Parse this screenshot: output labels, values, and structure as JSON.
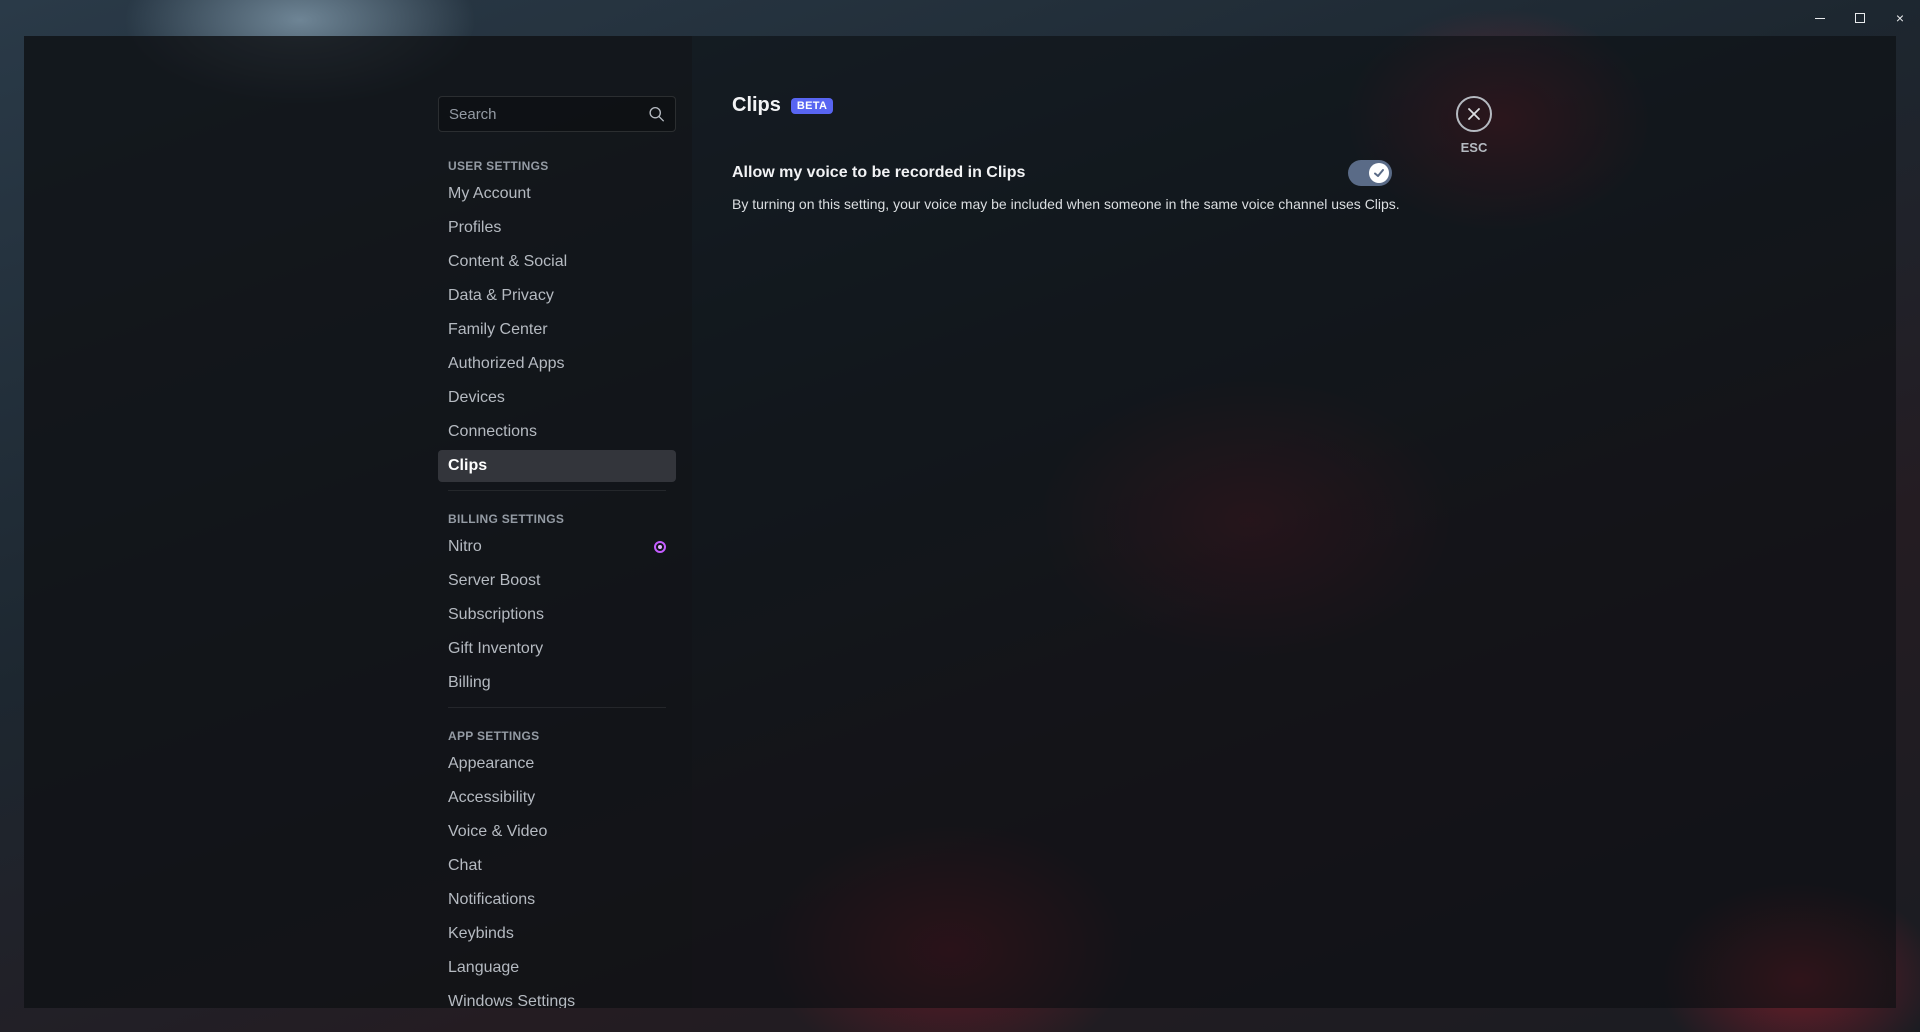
{
  "window_controls": {
    "minimize": "minimize",
    "maximize": "maximize",
    "close": "×"
  },
  "sidebar": {
    "search": {
      "placeholder": "Search",
      "value": ""
    },
    "sections": [
      {
        "header": "User Settings",
        "items": [
          {
            "label": "My Account"
          },
          {
            "label": "Profiles"
          },
          {
            "label": "Content & Social"
          },
          {
            "label": "Data & Privacy"
          },
          {
            "label": "Family Center"
          },
          {
            "label": "Authorized Apps"
          },
          {
            "label": "Devices"
          },
          {
            "label": "Connections"
          },
          {
            "label": "Clips",
            "active": true
          }
        ]
      },
      {
        "header": "Billing Settings",
        "items": [
          {
            "label": "Nitro",
            "badge": "nitro-icon"
          },
          {
            "label": "Server Boost"
          },
          {
            "label": "Subscriptions"
          },
          {
            "label": "Gift Inventory"
          },
          {
            "label": "Billing"
          }
        ]
      },
      {
        "header": "App Settings",
        "items": [
          {
            "label": "Appearance"
          },
          {
            "label": "Accessibility"
          },
          {
            "label": "Voice & Video"
          },
          {
            "label": "Chat"
          },
          {
            "label": "Notifications"
          },
          {
            "label": "Keybinds"
          },
          {
            "label": "Language"
          },
          {
            "label": "Windows Settings"
          }
        ]
      }
    ]
  },
  "content": {
    "title": "Clips",
    "badge": "BETA",
    "setting": {
      "label": "Allow my voice to be recorded in Clips",
      "enabled": true,
      "description": "By turning on this setting, your voice may be included when someone in the same voice channel uses Clips."
    },
    "close": {
      "label": "ESC"
    }
  },
  "colors": {
    "accent": "#5865f2",
    "toggle_on": "#5a6b87",
    "nitro": "#c45cff"
  }
}
